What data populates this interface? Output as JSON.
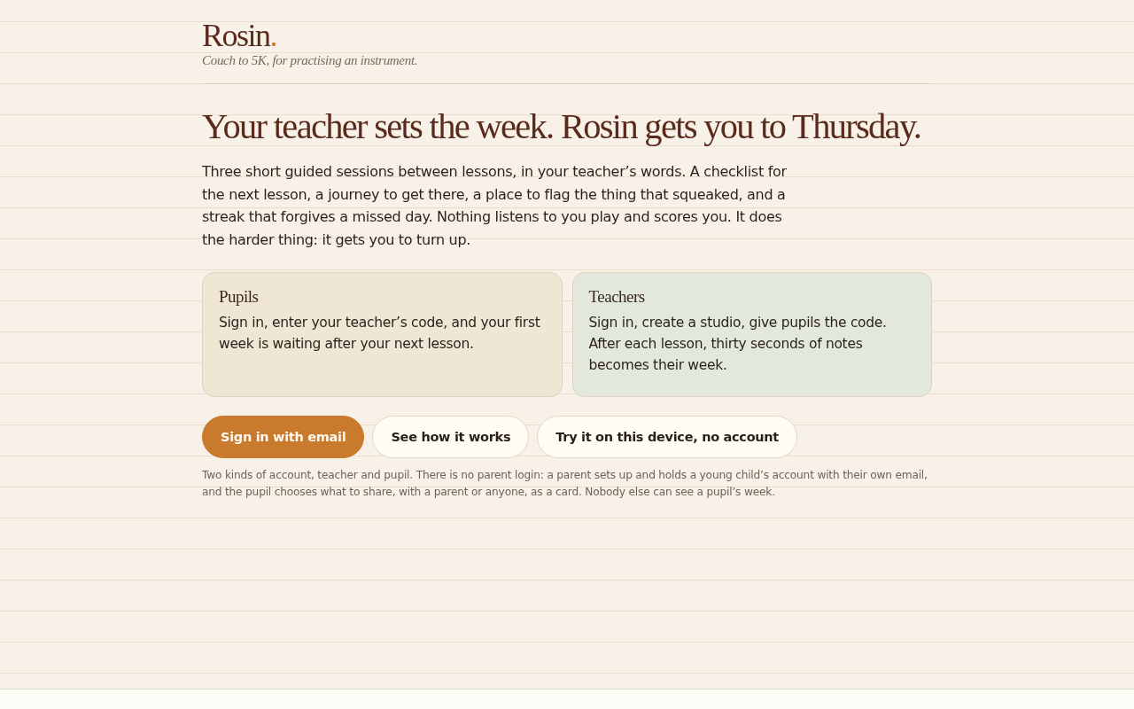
{
  "brand": {
    "name": "Rosin",
    "dot": ".",
    "tagline": "Couch to 5K, for practising an instrument."
  },
  "headline": "Your teacher sets the week. Rosin gets you to Thursday.",
  "intro": "Three short guided sessions between lessons, in your teacher’s words. A checklist for the next lesson, a journey to get there, a place to flag the thing that squeaked, and a streak that forgives a missed day. Nothing listens to you play and scores you. It does the harder thing: it gets you to turn up.",
  "cards": [
    {
      "title": "Pupils",
      "text": "Sign in, enter your teacher’s code, and your first week is waiting after your next lesson.",
      "color": "#f0e6d4"
    },
    {
      "title": "Teachers",
      "text": "Sign in, create a studio, give pupils the code. After each lesson, thirty seconds of notes becomes their week.",
      "color": "#e3e8dd"
    }
  ],
  "buttons": [
    {
      "label": "Sign in with email",
      "kind": "primary"
    },
    {
      "label": "See how it works",
      "kind": "secondary"
    },
    {
      "label": "Try it on this device, no account",
      "kind": "secondary"
    }
  ],
  "note": "Two kinds of account, teacher and pupil. There is no parent login: a parent sets up and holds a young child’s account with their own email, and the pupil chooses what to share, with a parent or anyone, as a card. Nobody else can see a pupil’s week."
}
